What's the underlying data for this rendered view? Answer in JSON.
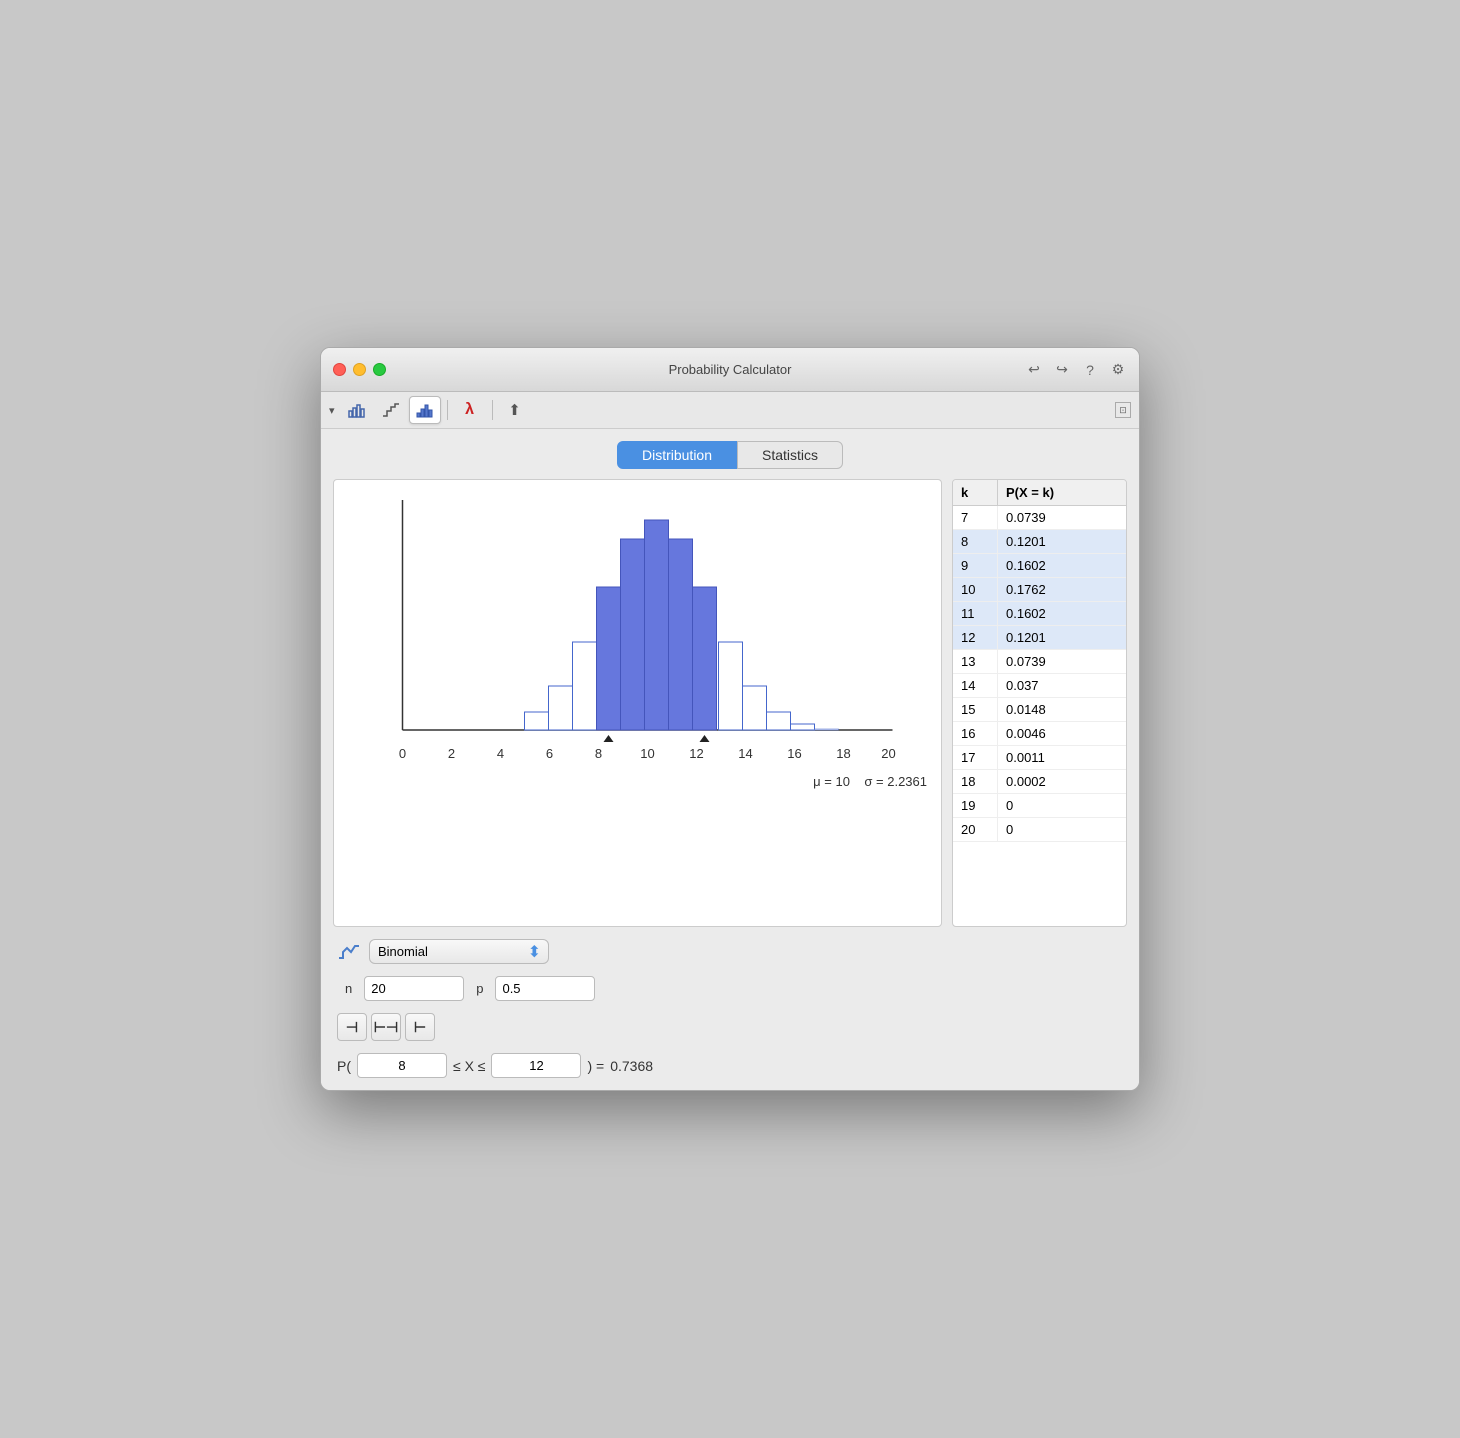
{
  "window": {
    "title": "Probability Calculator"
  },
  "toolbar": {
    "arrow_label": "▾",
    "export_label": "⬆"
  },
  "tabs": {
    "distribution_label": "Distribution",
    "statistics_label": "Statistics",
    "active": "distribution"
  },
  "chart": {
    "mu_label": "μ = 10",
    "sigma_label": "σ = 2.2361",
    "x_labels": [
      "0",
      "2",
      "4",
      "6",
      "8",
      "10",
      "12",
      "14",
      "16",
      "18",
      "20"
    ]
  },
  "table": {
    "col_k": "k",
    "col_px": "P(X = k)",
    "rows": [
      {
        "k": "7",
        "px": "0.0739",
        "highlighted": false
      },
      {
        "k": "8",
        "px": "0.1201",
        "highlighted": true
      },
      {
        "k": "9",
        "px": "0.1602",
        "highlighted": true
      },
      {
        "k": "10",
        "px": "0.1762",
        "highlighted": true
      },
      {
        "k": "11",
        "px": "0.1602",
        "highlighted": true
      },
      {
        "k": "12",
        "px": "0.1201",
        "highlighted": true
      },
      {
        "k": "13",
        "px": "0.0739",
        "highlighted": false
      },
      {
        "k": "14",
        "px": "0.037",
        "highlighted": false
      },
      {
        "k": "15",
        "px": "0.0148",
        "highlighted": false
      },
      {
        "k": "16",
        "px": "0.0046",
        "highlighted": false
      },
      {
        "k": "17",
        "px": "0.0011",
        "highlighted": false
      },
      {
        "k": "18",
        "px": "0.0002",
        "highlighted": false
      },
      {
        "k": "19",
        "px": "0",
        "highlighted": false
      },
      {
        "k": "20",
        "px": "0",
        "highlighted": false
      }
    ]
  },
  "controls": {
    "distribution_label": "Binomial",
    "n_label": "n",
    "n_value": "20",
    "p_label": "p",
    "p_value": "0.5",
    "prob_label_p": "P(",
    "prob_lower": "8",
    "prob_leq1": "≤ X ≤",
    "prob_upper": "12",
    "prob_label_end": ") =",
    "prob_result": "0.7368"
  }
}
